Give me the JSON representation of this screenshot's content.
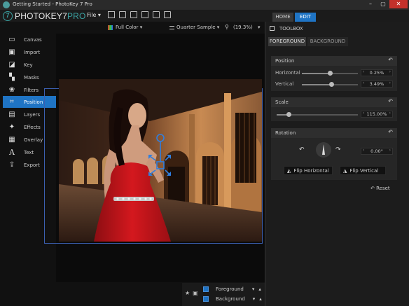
{
  "window": {
    "title": "Getting Started - PhotoKey 7 Pro",
    "minimize": "–",
    "maximize": "▢",
    "close": "✕"
  },
  "app": {
    "logo_main": "PHOTOKEY7",
    "logo_suffix": "PRO",
    "logo_mark": "7",
    "file_menu": "File ▾",
    "tabs": {
      "home": "HOME",
      "edit": "EDIT"
    }
  },
  "view_bar": {
    "color_mode": "Full Color ▾",
    "sample": "Quarter Sample ▾",
    "zoom": "(19.3%)",
    "zoom_caret": "▾"
  },
  "sidebar": {
    "items": [
      {
        "label": "Canvas",
        "icon": "canvas-icon",
        "glyph": "▭"
      },
      {
        "label": "Import",
        "icon": "import-icon",
        "glyph": "▣"
      },
      {
        "label": "Key",
        "icon": "key-icon",
        "glyph": "◪"
      },
      {
        "label": "Masks",
        "icon": "masks-icon",
        "glyph": "▚"
      },
      {
        "label": "Filters",
        "icon": "filters-icon",
        "glyph": "❀"
      },
      {
        "label": "Position",
        "icon": "position-icon",
        "glyph": "⌗"
      },
      {
        "label": "Layers",
        "icon": "layers-icon",
        "glyph": "▤"
      },
      {
        "label": "Effects",
        "icon": "effects-icon",
        "glyph": "✦"
      },
      {
        "label": "Overlay",
        "icon": "overlay-icon",
        "glyph": "▦"
      },
      {
        "label": "Text",
        "icon": "text-icon",
        "glyph": "A"
      },
      {
        "label": "Export",
        "icon": "export-icon",
        "glyph": "⇪"
      }
    ],
    "active_index": 5
  },
  "layers": {
    "foreground": "Foreground",
    "background": "Background",
    "caret": "▾",
    "up": "▴"
  },
  "toolbox": {
    "title": "TOOLBOX",
    "tabs": {
      "foreground": "FOREGROUND",
      "background": "BACKGROUND"
    },
    "position": {
      "title": "Position",
      "horizontal_label": "Horizontal",
      "horizontal_value": "0.25%",
      "horizontal_level": 0.5,
      "vertical_label": "Vertical",
      "vertical_value": "3.49%",
      "vertical_level": 0.52
    },
    "scale": {
      "title": "Scale",
      "value": "115.00%",
      "level": 0.15
    },
    "rotation": {
      "title": "Rotation",
      "value": "0.00°",
      "flip_horizontal": "Flip Horizontal",
      "flip_vertical": "Flip Vertical"
    },
    "reset": "Reset",
    "undo_glyph": "↶"
  },
  "colors": {
    "accent": "#1f74c4",
    "dress": "#c4161c",
    "logo_teal": "#3aa0a0",
    "close": "#c4312b"
  }
}
